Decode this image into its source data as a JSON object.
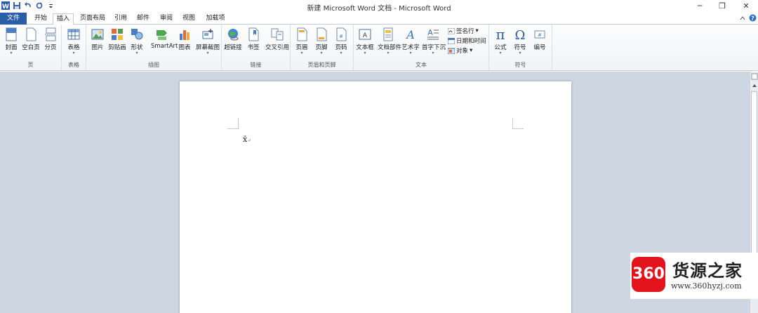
{
  "window": {
    "title": "新建 Microsoft Word 文档 - Microsoft Word",
    "minimize": "─",
    "restore": "❐",
    "close": "✕"
  },
  "tabs": [
    {
      "label": "文件"
    },
    {
      "label": "开始"
    },
    {
      "label": "插入"
    },
    {
      "label": "页面布局"
    },
    {
      "label": "引用"
    },
    {
      "label": "邮件"
    },
    {
      "label": "审阅"
    },
    {
      "label": "视图"
    },
    {
      "label": "加载项"
    }
  ],
  "ribbon": {
    "groups": {
      "pages": "页",
      "tables": "表格",
      "illustrations": "插图",
      "links": "链接",
      "header_footer": "页眉和页脚",
      "text": "文本",
      "symbols": "符号"
    },
    "buttons": {
      "cover": "封面",
      "blank_page": "空白页",
      "page_break": "分页",
      "table": "表格",
      "picture": "图片",
      "clip_art": "剪贴画",
      "shapes": "形状",
      "smartart": "SmartArt",
      "chart": "图表",
      "screenshot": "屏幕截图",
      "hyperlink": "超链接",
      "bookmark": "书签",
      "cross_ref": "交叉引用",
      "header": "页眉",
      "footer": "页脚",
      "page_number": "页码",
      "text_box": "文本框",
      "quick_parts": "文档部件",
      "wordart": "艺术字",
      "drop_cap": "首字下沉",
      "signature_line": "签名行",
      "date_time": "日期和时间",
      "object": "对象",
      "equation": "公式",
      "symbol": "符号",
      "number": "编号"
    }
  },
  "document": {
    "text": "x̄",
    "para_mark": "↵"
  },
  "watermark": {
    "logo": "360",
    "brand": "货源之家",
    "url": "www.360hyzj.com"
  },
  "colors": {
    "file_tab": "#2a5ea8",
    "doc_bg": "#ced6e2",
    "logo_red": "#e3131b"
  }
}
